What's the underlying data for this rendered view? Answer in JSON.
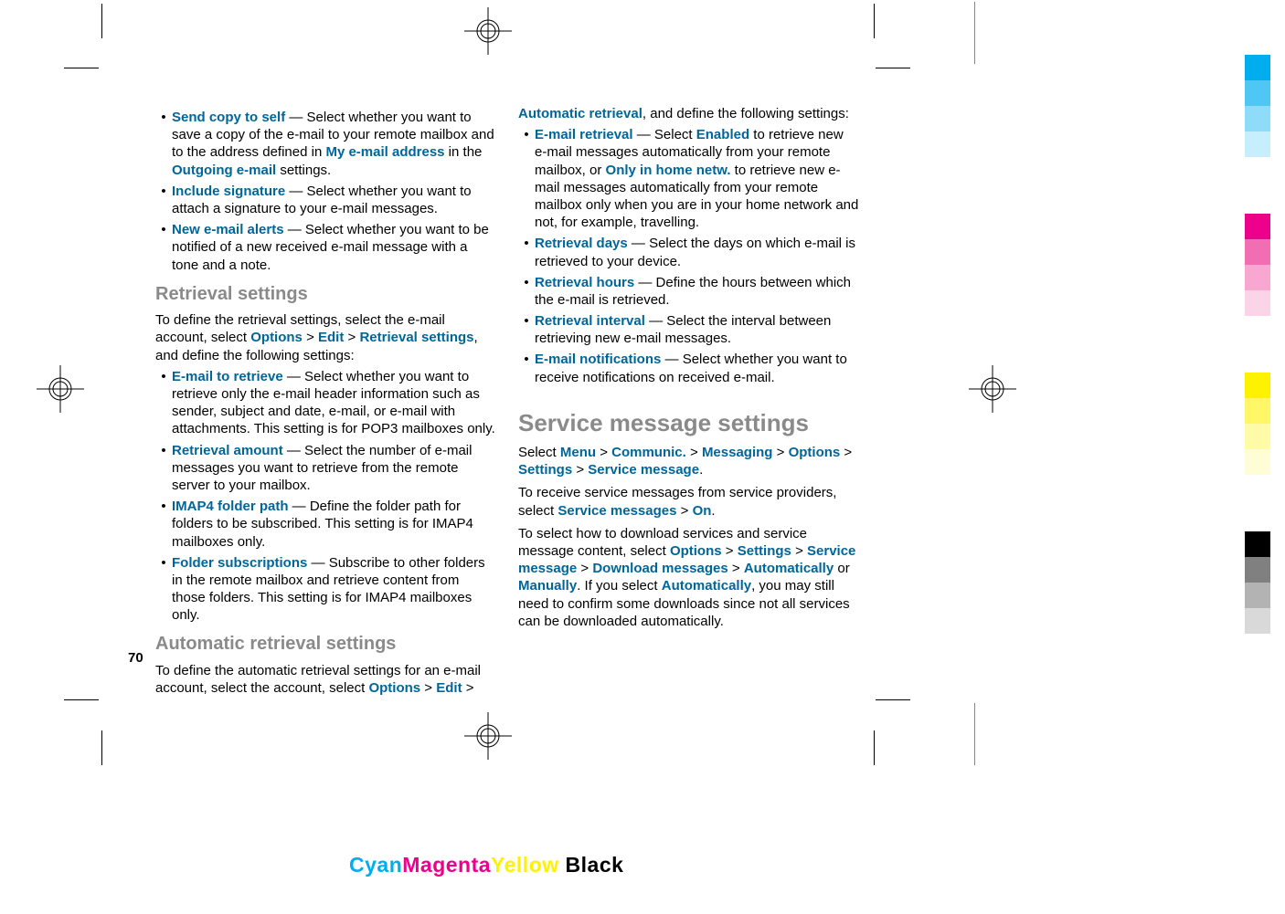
{
  "pageNumber": "70",
  "col1": {
    "bullets1": [
      {
        "term": "Send copy to self",
        "desc1": " — Select whether you want to save a copy of the e-mail to your remote mailbox and to the address defined in ",
        "term2": "My e-mail address",
        "desc2": " in the ",
        "term3": "Outgoing e-mail",
        "desc3": " settings."
      },
      {
        "term": "Include signature",
        "desc1": " — Select whether you want to attach a signature to your e-mail messages."
      },
      {
        "term": "New e-mail alerts",
        "desc1": " — Select whether you want to be notified of a new received e-mail message with a tone and a note."
      }
    ],
    "h_retrieval": "Retrieval settings",
    "p_retrieval_1a": "To define the retrieval settings, select the e-mail account, select ",
    "p_retrieval_opts": "Options",
    "p_gt": " > ",
    "p_retrieval_edit": "Edit",
    "p_retrieval_rs": "Retrieval settings",
    "p_retrieval_1b": ", and define the following settings:",
    "bullets2": [
      {
        "term": "E-mail to retrieve",
        "desc1": " — Select whether you want to retrieve only the e-mail header information such as sender, subject and date, e-mail, or e-mail with attachments. This setting is for POP3 mailboxes only."
      },
      {
        "term": "Retrieval amount",
        "desc1": " — Select the number of e-mail messages you want to retrieve from the remote server to your mailbox."
      },
      {
        "term": "IMAP4 folder path",
        "desc1": " — Define the folder path for folders to be subscribed. This setting is for IMAP4 mailboxes only."
      },
      {
        "term": "Folder subscriptions",
        "desc1": " — Subscribe to other folders in the remote mailbox and retrieve content from those folders. This setting is for IMAP4 mailboxes only."
      }
    ],
    "h_auto": "Automatic retrieval settings",
    "p_auto_1a": "To define the automatic retrieval settings for an e-mail account, select the account, select ",
    "p_auto_opts": "Options",
    "p_auto_edit": "Edit"
  },
  "col2": {
    "p_intro_term": "Automatic retrieval",
    "p_intro_rest": ", and define the following settings:",
    "bullets": [
      {
        "term": "E-mail retrieval",
        "desc1": " — Select ",
        "term2": "Enabled",
        "desc2": " to retrieve new e-mail messages automatically from your remote mailbox, or ",
        "term3": "Only in home netw.",
        "desc3": " to retrieve new e-mail messages automatically from your remote mailbox only when you are in your home network and not, for example, travelling."
      },
      {
        "term": "Retrieval days",
        "desc1": " — Select the days on which e-mail is retrieved to your device."
      },
      {
        "term": "Retrieval hours",
        "desc1": " — Define the hours between which the e-mail is retrieved."
      },
      {
        "term": "Retrieval interval",
        "desc1": " — Select the interval between retrieving new e-mail messages."
      },
      {
        "term": "E-mail notifications",
        "desc1": " — Select whether you want to receive notifications on received e-mail."
      }
    ],
    "h_service": "Service message settings",
    "sm_select": "Select ",
    "sm_menu": "Menu",
    "sm_communic": "Communic.",
    "sm_messaging": "Messaging",
    "sm_options": "Options",
    "sm_settings": "Settings",
    "sm_service": "Service message",
    "sm_dot": ".",
    "p2a": "To receive service messages from service providers, select ",
    "p2_term": "Service messages",
    "p2_on": "On",
    "p3a": "To select how to download services and service message content, select ",
    "p3_opts": "Options",
    "p3_settings": "Settings",
    "p3_sm": "Service message",
    "p3_dm": "Download messages",
    "p3_auto": "Automatically",
    "p3_or": " or ",
    "p3_man": "Manually",
    "p3b": ". If you select ",
    "p3_auto2": "Automatically",
    "p3c": ", you may still need to confirm some downloads since not all services can be downloaded automatically."
  },
  "cmyk": {
    "c": "Cyan",
    "m": "Magenta",
    "y": "Yellow",
    "k": "Black"
  },
  "colorbar": [
    "#00aeef",
    "#4fc6f3",
    "#8edcf8",
    "#c6eefc",
    "gap",
    "#ec008c",
    "#f26eb3",
    "#f8a8d0",
    "#fcd4e8",
    "gap",
    "#fff200",
    "#fff766",
    "#fffba6",
    "#fffdd6",
    "gap",
    "#000000",
    "#808080",
    "#b3b3b3",
    "#d9d9d9"
  ]
}
